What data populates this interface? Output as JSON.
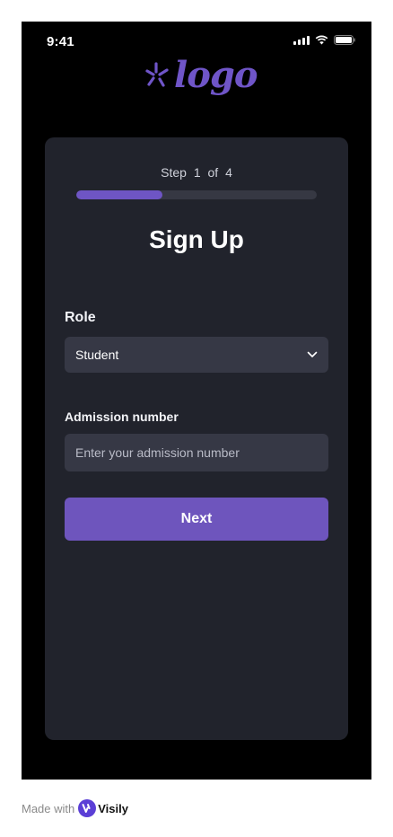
{
  "status_bar": {
    "time": "9:41"
  },
  "logo": {
    "text": "logo",
    "color": "#6f55c8"
  },
  "signup": {
    "step_label": "Step",
    "step_current": "1",
    "step_of": "of",
    "step_total": "4",
    "progress_fraction": 0.36,
    "title": "Sign Up"
  },
  "form": {
    "role_label": "Role",
    "role_value": "Student",
    "admission_label": "Admission number",
    "admission_placeholder": "Enter your admission number",
    "next_label": "Next"
  },
  "footer": {
    "made_with": "Made with",
    "brand": "Visily"
  },
  "colors": {
    "accent": "#6e55bd",
    "card": "#21232c",
    "field": "#363845"
  }
}
